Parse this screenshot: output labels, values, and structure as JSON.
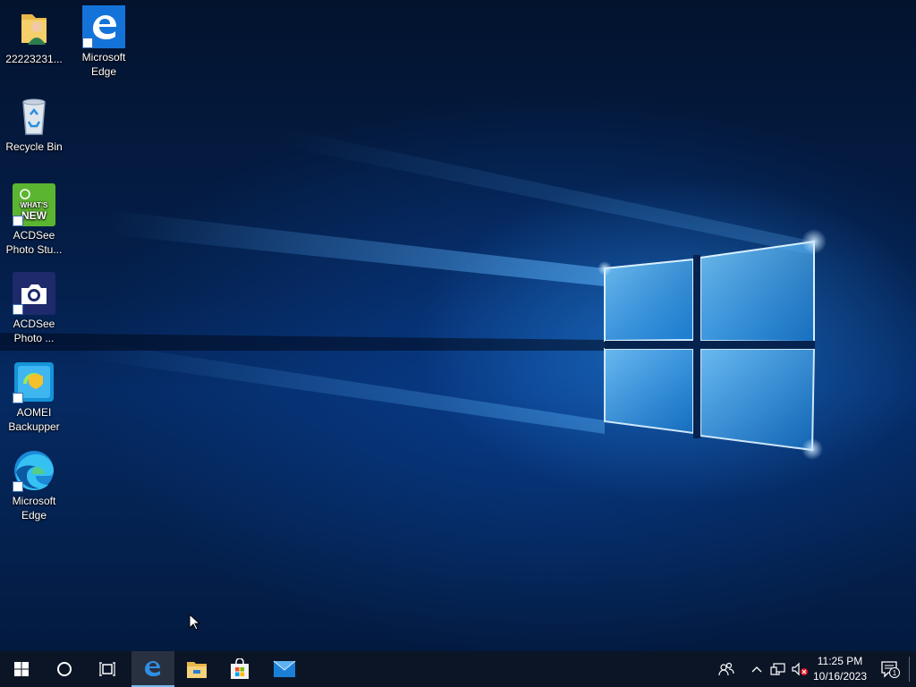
{
  "desktop": {
    "icons": [
      {
        "id": "user-folder",
        "label": "22223231...",
        "icon": "user-folder-icon",
        "shortcut": false
      },
      {
        "id": "edge-legacy",
        "label": "Microsoft\nEdge",
        "icon": "edge-legacy-icon",
        "shortcut": true
      },
      {
        "id": "recycle-bin",
        "label": "Recycle Bin",
        "icon": "recycle-bin-icon",
        "shortcut": false
      },
      {
        "id": "acdsee-new",
        "label": "ACDSee\nPhoto Stu...",
        "icon": "acdsee-whats-new-icon",
        "shortcut": true,
        "badge": [
          "WHAT'S",
          "NEW"
        ]
      },
      {
        "id": "acdsee-photo",
        "label": "ACDSee\nPhoto ...",
        "icon": "acdsee-camera-icon",
        "shortcut": true
      },
      {
        "id": "aomei",
        "label": "AOMEI\nBackupper",
        "icon": "aomei-backupper-icon",
        "shortcut": true
      },
      {
        "id": "edge-chromium",
        "label": "Microsoft\nEdge",
        "icon": "edge-chromium-icon",
        "shortcut": true
      }
    ]
  },
  "taskbar": {
    "buttons": [
      {
        "id": "start",
        "icon": "windows-start-icon"
      },
      {
        "id": "search",
        "icon": "cortana-circle-icon"
      },
      {
        "id": "task-view",
        "icon": "task-view-icon"
      },
      {
        "id": "edge",
        "icon": "edge-legacy-icon",
        "active": true
      },
      {
        "id": "explorer",
        "icon": "file-explorer-icon"
      },
      {
        "id": "store",
        "icon": "microsoft-store-icon"
      },
      {
        "id": "mail",
        "icon": "mail-icon"
      }
    ],
    "tray": {
      "icons": [
        "people-icon",
        "chevron-up-icon",
        "network-icon",
        "volume-muted-icon"
      ],
      "time": "11:25 PM",
      "date": "10/16/2023",
      "notification_count": "1"
    }
  },
  "colors": {
    "taskbar_bg": "#0c1526",
    "accent": "#76b9ed",
    "desktop_bg": "#04204d"
  }
}
